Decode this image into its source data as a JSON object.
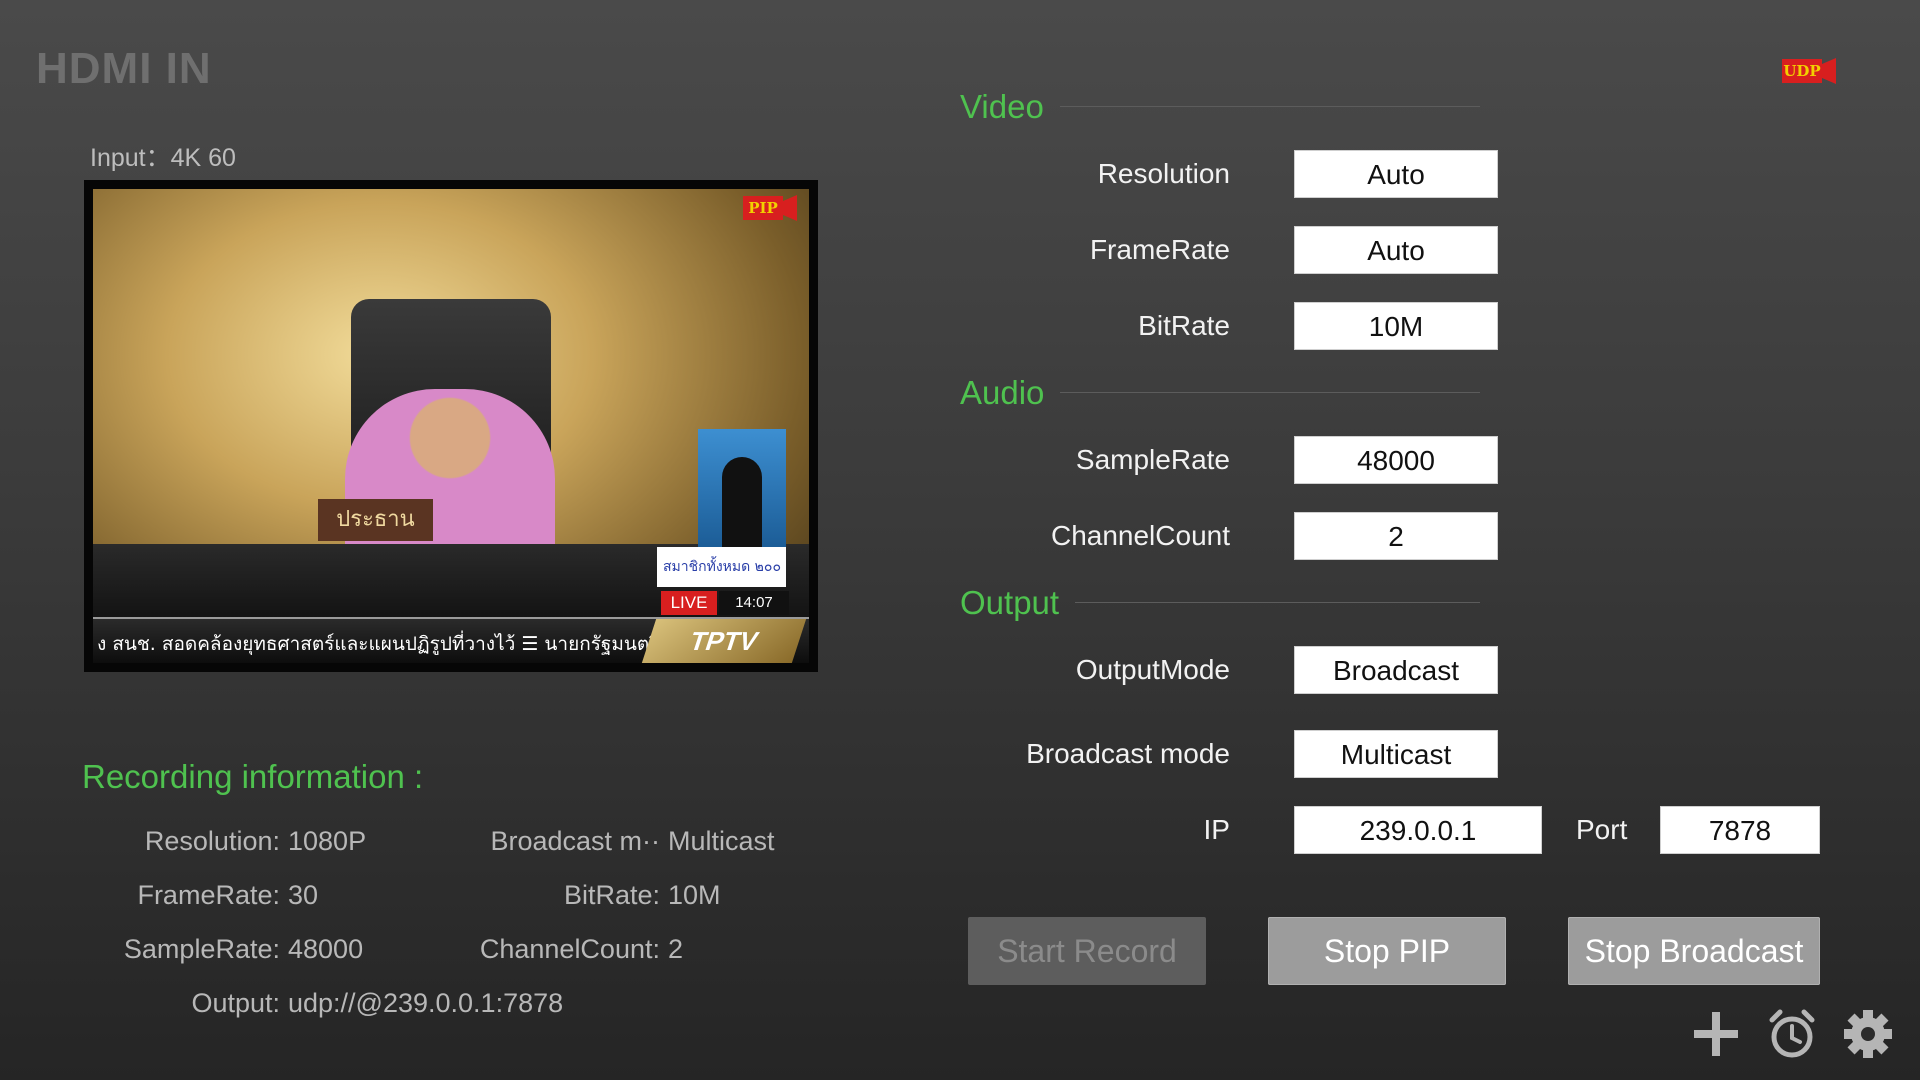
{
  "app": {
    "title": "HDMI IN",
    "udp_badge": "UDP"
  },
  "preview": {
    "input_label": "Input：4K 60",
    "pip_badge": "PIP",
    "nameplate": "ประธาน",
    "ticker_text": "ง สนช. สอดคล้องยุทธศาสตร์และแผนปฏิรูปที่วางไว้  ☰  นายกรัฐมนตรี",
    "counter_text": "สมาชิกทั้งหมด ๒๐๐",
    "live_label": "LIVE",
    "time": "14:07",
    "channel_logo": "TPTV"
  },
  "recording": {
    "title": "Recording information :",
    "rows": [
      {
        "label": "Resolution:",
        "value": "1080P"
      },
      {
        "label": "FrameRate:",
        "value": "30"
      },
      {
        "label": "SampleRate:",
        "value": "48000"
      },
      {
        "label": "Output:",
        "value": "udp://@239.0.0.1:7878"
      }
    ],
    "rows_right": [
      {
        "label": "Broadcast m··",
        "value": "Multicast"
      },
      {
        "label": "BitRate:",
        "value": "10M"
      },
      {
        "label": "ChannelCount:",
        "value": "2"
      }
    ]
  },
  "video": {
    "title": "Video",
    "resolution_label": "Resolution",
    "resolution_value": "Auto",
    "framerate_label": "FrameRate",
    "framerate_value": "Auto",
    "bitrate_label": "BitRate",
    "bitrate_value": "10M"
  },
  "audio": {
    "title": "Audio",
    "samplerate_label": "SampleRate",
    "samplerate_value": "48000",
    "channelcount_label": "ChannelCount",
    "channelcount_value": "2"
  },
  "output": {
    "title": "Output",
    "outputmode_label": "OutputMode",
    "outputmode_value": "Broadcast",
    "broadcastmode_label": "Broadcast mode",
    "broadcastmode_value": "Multicast",
    "ip_label": "IP",
    "ip_value": "239.0.0.1",
    "port_label": "Port",
    "port_value": "7878"
  },
  "buttons": {
    "start_record": "Start Record",
    "stop_pip": "Stop PIP",
    "stop_broadcast": "Stop Broadcast"
  },
  "colors": {
    "accent_green": "#4fc24f",
    "badge_red": "#d81f1f",
    "badge_yellow": "#f2d000"
  },
  "icons": [
    "plus-icon",
    "alarm-clock-icon",
    "gear-icon"
  ]
}
